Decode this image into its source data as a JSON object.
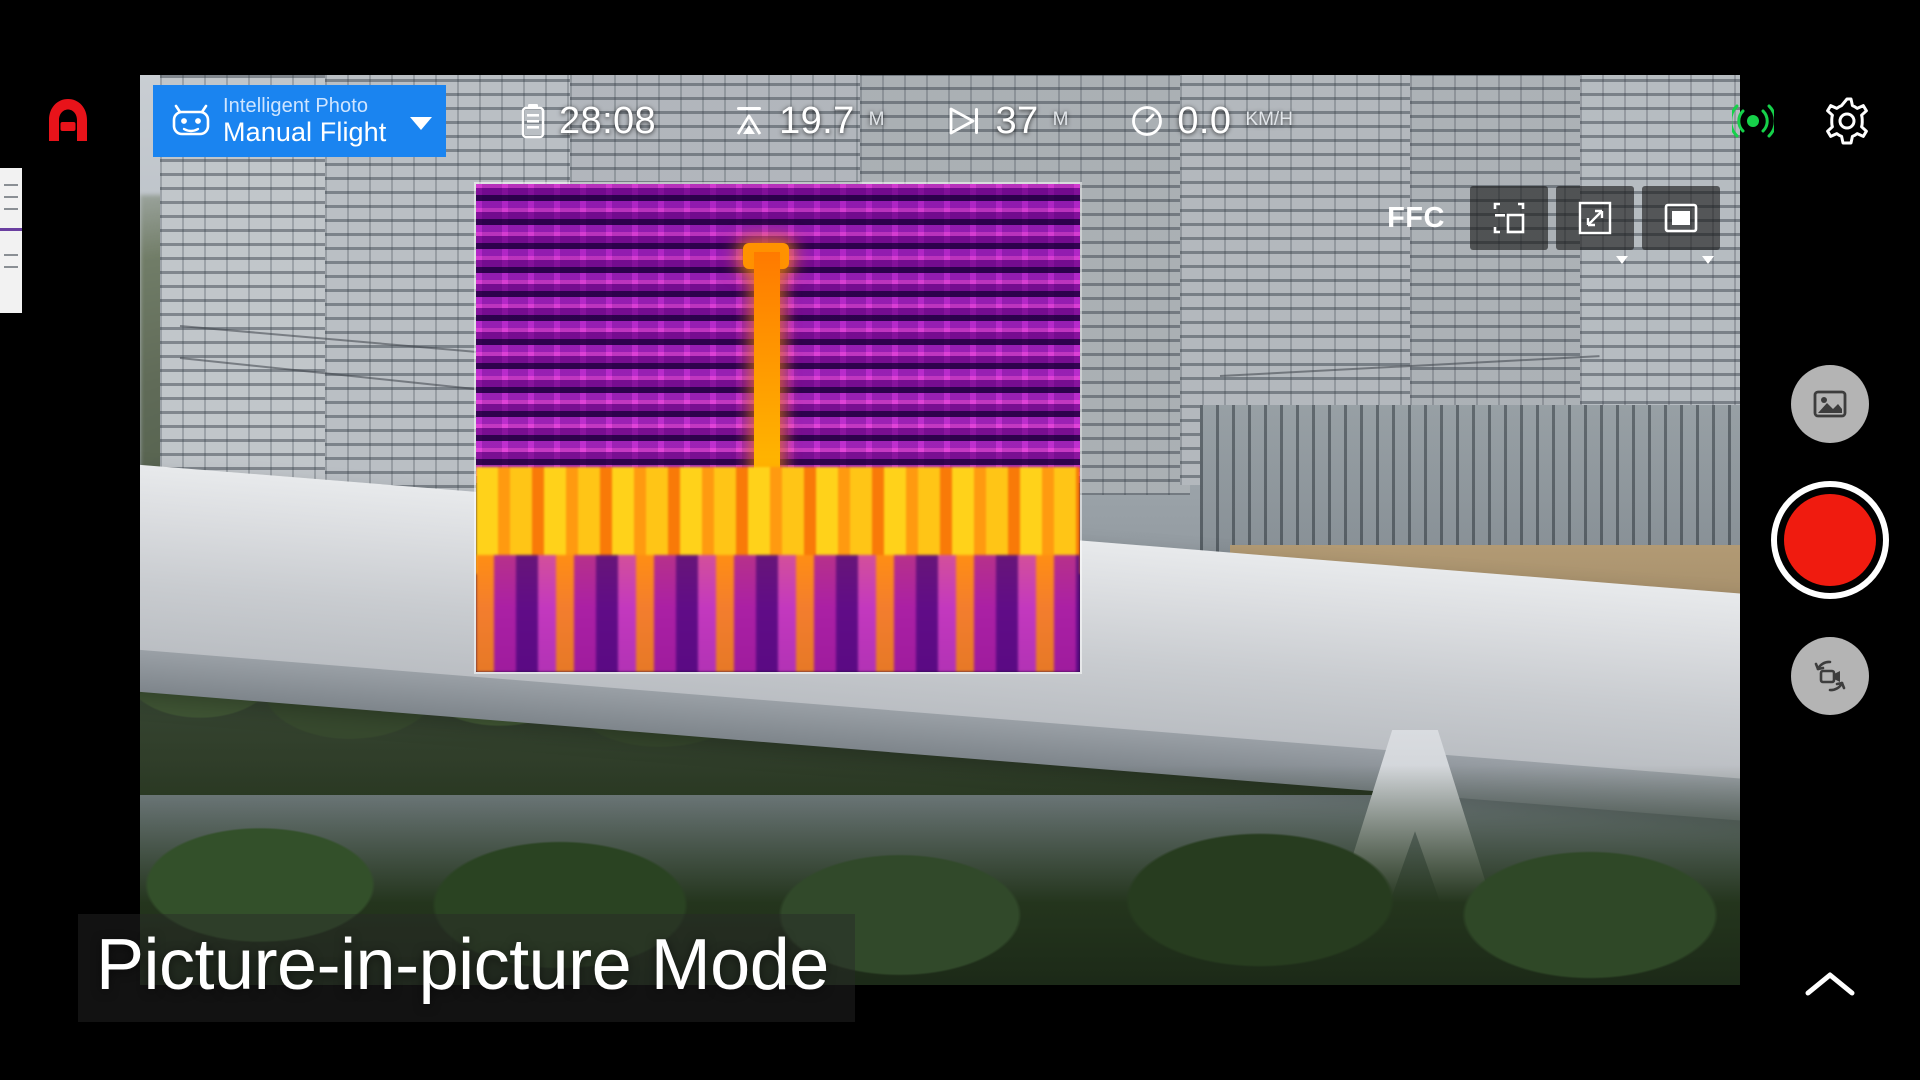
{
  "app": {
    "logo_icon": "brand-a-logo",
    "logo_color": "#e8131a",
    "accent_color": "#1a84f0",
    "shutter_color": "#f01b0f",
    "signal_color": "#16d14a"
  },
  "mode_selector": {
    "icon": "gamepad-icon",
    "subtitle": "Intelligent Photo",
    "title": "Manual Flight",
    "caret_icon": "chevron-down-icon"
  },
  "telemetry": [
    {
      "icon": "battery-icon",
      "value": "28:08",
      "unit": ""
    },
    {
      "icon": "altitude-icon",
      "value": "19.7",
      "unit": "M"
    },
    {
      "icon": "distance-icon",
      "value": "37",
      "unit": "M"
    },
    {
      "icon": "speed-icon",
      "value": "0.0",
      "unit": "KM/H"
    }
  ],
  "top_right": {
    "signal_icon": "signal-strength-icon",
    "settings_icon": "gear-icon"
  },
  "camera_toolbar": [
    {
      "name": "ffc-button",
      "label": "FFC",
      "icon": "",
      "has_caret": false
    },
    {
      "name": "pip-position-button",
      "label": "",
      "icon": "pip-corner-icon",
      "has_caret": false
    },
    {
      "name": "zoom-expand-button",
      "label": "",
      "icon": "expand-arrows-icon",
      "has_caret": true
    },
    {
      "name": "display-layout-button",
      "label": "",
      "icon": "pip-layout-icon",
      "has_caret": true
    }
  ],
  "right_rail": {
    "gallery_icon": "gallery-image-icon",
    "shutter_label": "shutter-button",
    "switch_icon": "camera-video-switch-icon",
    "collapse_icon": "chevron-up-icon"
  },
  "caption": {
    "text": "Picture-in-picture Mode"
  },
  "pip_overlay": {
    "name": "thermal-picture-in-picture",
    "palette": "ironbow-magenta"
  }
}
